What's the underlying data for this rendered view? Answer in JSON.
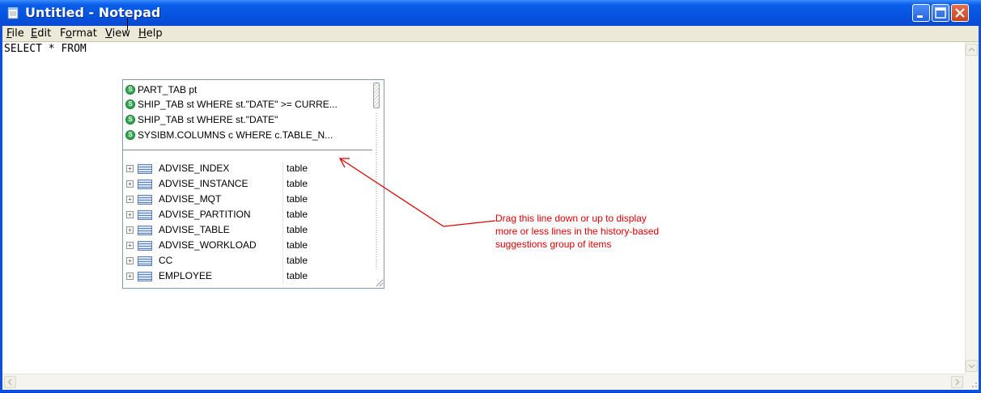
{
  "window": {
    "title": "Untitled - Notepad",
    "icon": "notepad-icon",
    "controls": {
      "minimize": "minimize-icon",
      "maximize": "maximize-icon",
      "close": "close-icon"
    }
  },
  "menu": {
    "items": [
      {
        "label_u": "F",
        "label_rest": "ile"
      },
      {
        "label_u": "E",
        "label_rest": "dit"
      },
      {
        "label_pre": "F",
        "label_u": "o",
        "label_rest": "rmat"
      },
      {
        "label_u": "V",
        "label_rest": "iew"
      },
      {
        "label_u": "H",
        "label_rest": "elp"
      }
    ]
  },
  "editor": {
    "text": "SELECT * FROM "
  },
  "autocomplete": {
    "history": [
      {
        "label": "PART_TAB pt"
      },
      {
        "label": "SHIP_TAB st WHERE st.\"DATE\" >= CURRE..."
      },
      {
        "label": "SHIP_TAB st WHERE st.\"DATE\""
      },
      {
        "label": "SYSIBM.COLUMNS c WHERE c.TABLE_N..."
      }
    ],
    "tables": [
      {
        "name": "ADVISE_INDEX",
        "type": "table"
      },
      {
        "name": "ADVISE_INSTANCE",
        "type": "table"
      },
      {
        "name": "ADVISE_MQT",
        "type": "table"
      },
      {
        "name": "ADVISE_PARTITION",
        "type": "table"
      },
      {
        "name": "ADVISE_TABLE",
        "type": "table"
      },
      {
        "name": "ADVISE_WORKLOAD",
        "type": "table"
      },
      {
        "name": "CC",
        "type": "table"
      },
      {
        "name": "EMPLOYEE",
        "type": "table"
      }
    ]
  },
  "annotation": {
    "lines": [
      "Drag this line down or up to display",
      "more or less lines in the history-based",
      "suggestions group of items"
    ],
    "color": "#e00000"
  },
  "colors": {
    "titlebar": "#0553e0",
    "menubar": "#ece9d8",
    "history_icon": "#2fa84f"
  }
}
